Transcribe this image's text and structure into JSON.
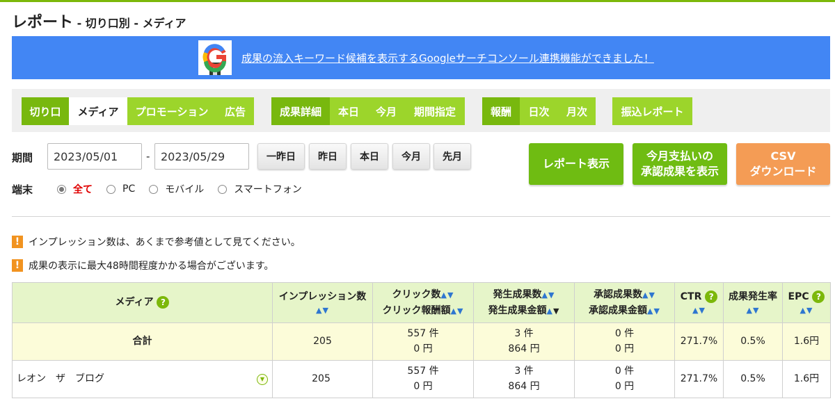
{
  "page": {
    "title": "レポート",
    "subtitle": " - 切り口別 - メディア"
  },
  "banner": {
    "logo_letter": "G",
    "link_text": "成果の流入キーワード候補を表示するGoogleサーチコンソール連携機能ができました！"
  },
  "tabs": {
    "group1": [
      "切り口",
      "メディア",
      "プロモーション",
      "広告"
    ],
    "group2": [
      "成果詳細",
      "本日",
      "今月",
      "期間指定"
    ],
    "group3": [
      "報酬",
      "日次",
      "月次"
    ],
    "group4": [
      "振込レポート"
    ]
  },
  "filters": {
    "period_label": "期間",
    "date_from": "2023/05/01",
    "date_sep": "-",
    "date_to": "2023/05/29",
    "quick_buttons": [
      "一昨日",
      "昨日",
      "本日",
      "今月",
      "先月"
    ],
    "device_label": "端末",
    "device_options": [
      "全て",
      "PC",
      "モバイル",
      "スマートフォン"
    ],
    "device_selected": "全て"
  },
  "actions": {
    "show_report": "レポート表示",
    "monthly_line1": "今月支払いの",
    "monthly_line2": "承認成果を表示",
    "csv_line1": "CSV",
    "csv_line2": "ダウンロード"
  },
  "notices": [
    "インプレッション数は、あくまで参考値として見てください。",
    "成果の表示に最大48時間程度かかる場合がございます。"
  ],
  "table": {
    "headers": {
      "media": "メディア",
      "impressions": "インプレッション数",
      "clicks": "クリック数",
      "click_reward": "クリック報酬額",
      "occurred_count": "発生成果数",
      "occurred_amount": "発生成果金額",
      "approved_count": "承認成果数",
      "approved_amount": "承認成果金額",
      "ctr": "CTR",
      "conversion_rate": "成果発生率",
      "epc": "EPC"
    },
    "sort_arrows": "▲▼",
    "sort_up": "▲",
    "sort_down_active": "▼",
    "help_icon": "?",
    "total_row": {
      "label": "合計",
      "impressions": "205",
      "clicks": "557 件",
      "click_reward": "0 円",
      "occurred_count": "3 件",
      "occurred_amount": "864 円",
      "approved_count": "0 件",
      "approved_amount": "0 円",
      "ctr": "271.7%",
      "conversion_rate": "0.5%",
      "epc": "1.6円"
    },
    "rows": [
      {
        "media": "レオン　ザ　ブログ",
        "impressions": "205",
        "clicks": "557 件",
        "click_reward": "0 円",
        "occurred_count": "3 件",
        "occurred_amount": "864 円",
        "approved_count": "0 件",
        "approved_amount": "0 円",
        "ctr": "271.7%",
        "conversion_rate": "0.5%",
        "epc": "1.6円"
      }
    ]
  },
  "colors": {
    "brand_green": "#7cb80a",
    "tab_green": "#9cd52b",
    "tab_dark_green": "#78b80e",
    "banner_blue": "#4286f4",
    "csv_orange": "#f49c55",
    "header_bg": "#e6f5c9",
    "total_bg": "#fcfcd9",
    "sort_blue": "#2e76d0",
    "selected_red": "#e00000",
    "warning_orange": "#f19320"
  }
}
